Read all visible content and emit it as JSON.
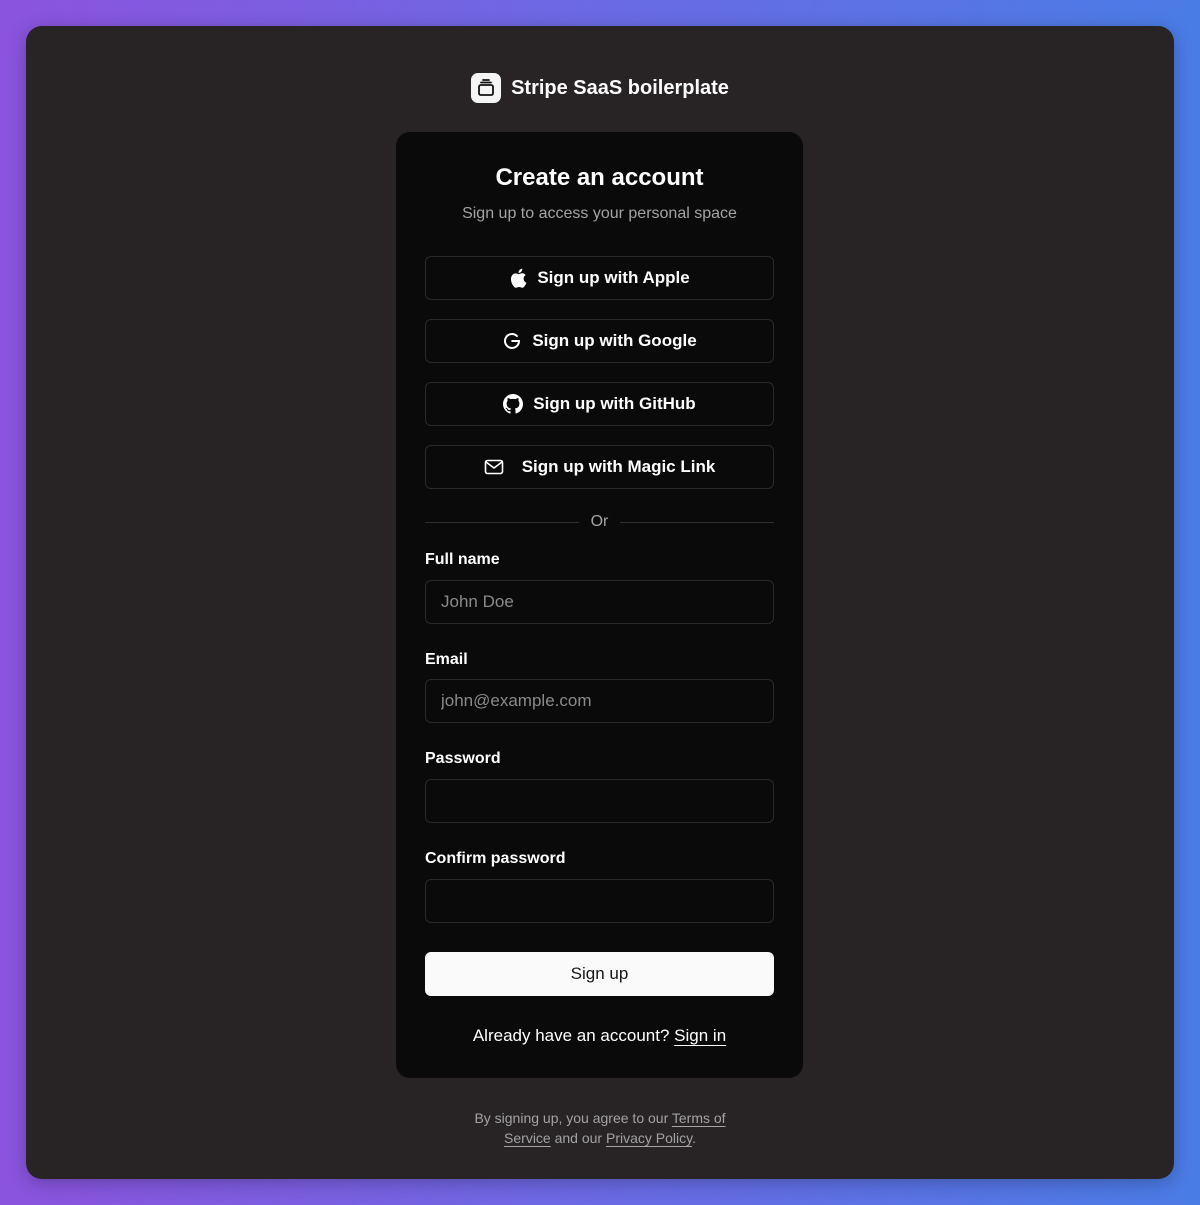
{
  "brand": {
    "name": "Stripe SaaS boilerplate",
    "logo_icon": "stack-icon"
  },
  "card": {
    "title": "Create an account",
    "subtitle": "Sign up to access your personal space"
  },
  "social": [
    {
      "label": "Sign up with Apple",
      "icon": "apple-icon"
    },
    {
      "label": "Sign up with Google",
      "icon": "google-icon"
    },
    {
      "label": "Sign up with GitHub",
      "icon": "github-icon"
    },
    {
      "label": "Sign up with Magic Link",
      "icon": "mail-icon"
    }
  ],
  "divider": "Or",
  "form": {
    "full_name": {
      "label": "Full name",
      "placeholder": "John Doe",
      "value": ""
    },
    "email": {
      "label": "Email",
      "placeholder": "john@example.com",
      "value": ""
    },
    "password": {
      "label": "Password",
      "placeholder": "",
      "value": ""
    },
    "confirm_password": {
      "label": "Confirm password",
      "placeholder": "",
      "value": ""
    },
    "submit_label": "Sign up"
  },
  "signin": {
    "prompt": "Already have an account?",
    "link": "Sign in"
  },
  "legal": {
    "prefix": "By signing up, you agree to our",
    "terms": "Terms of Service",
    "middle": "and our",
    "privacy": "Privacy Policy",
    "suffix": "."
  },
  "colors": {
    "card_bg": "#0a0a0a",
    "window_bg": "#282324",
    "primary_button": "#fafafa"
  }
}
